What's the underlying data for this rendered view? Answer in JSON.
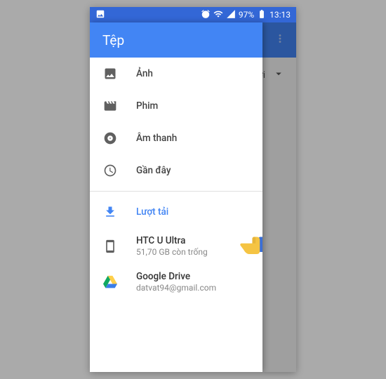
{
  "statusbar": {
    "battery_pct": "97%",
    "time": "13:13"
  },
  "backdrop": {
    "sort_label": "lới"
  },
  "drawer": {
    "title": "Tệp",
    "nav": [
      {
        "label": "Ảnh"
      },
      {
        "label": "Phim"
      },
      {
        "label": "Âm thanh"
      },
      {
        "label": "Gần đây"
      }
    ],
    "downloads_label": "Lượt tải",
    "storage": [
      {
        "title": "HTC U Ultra",
        "subtitle": "51,70 GB còn trống"
      },
      {
        "title": "Google Drive",
        "subtitle": "datvat94@gmail.com"
      }
    ]
  }
}
